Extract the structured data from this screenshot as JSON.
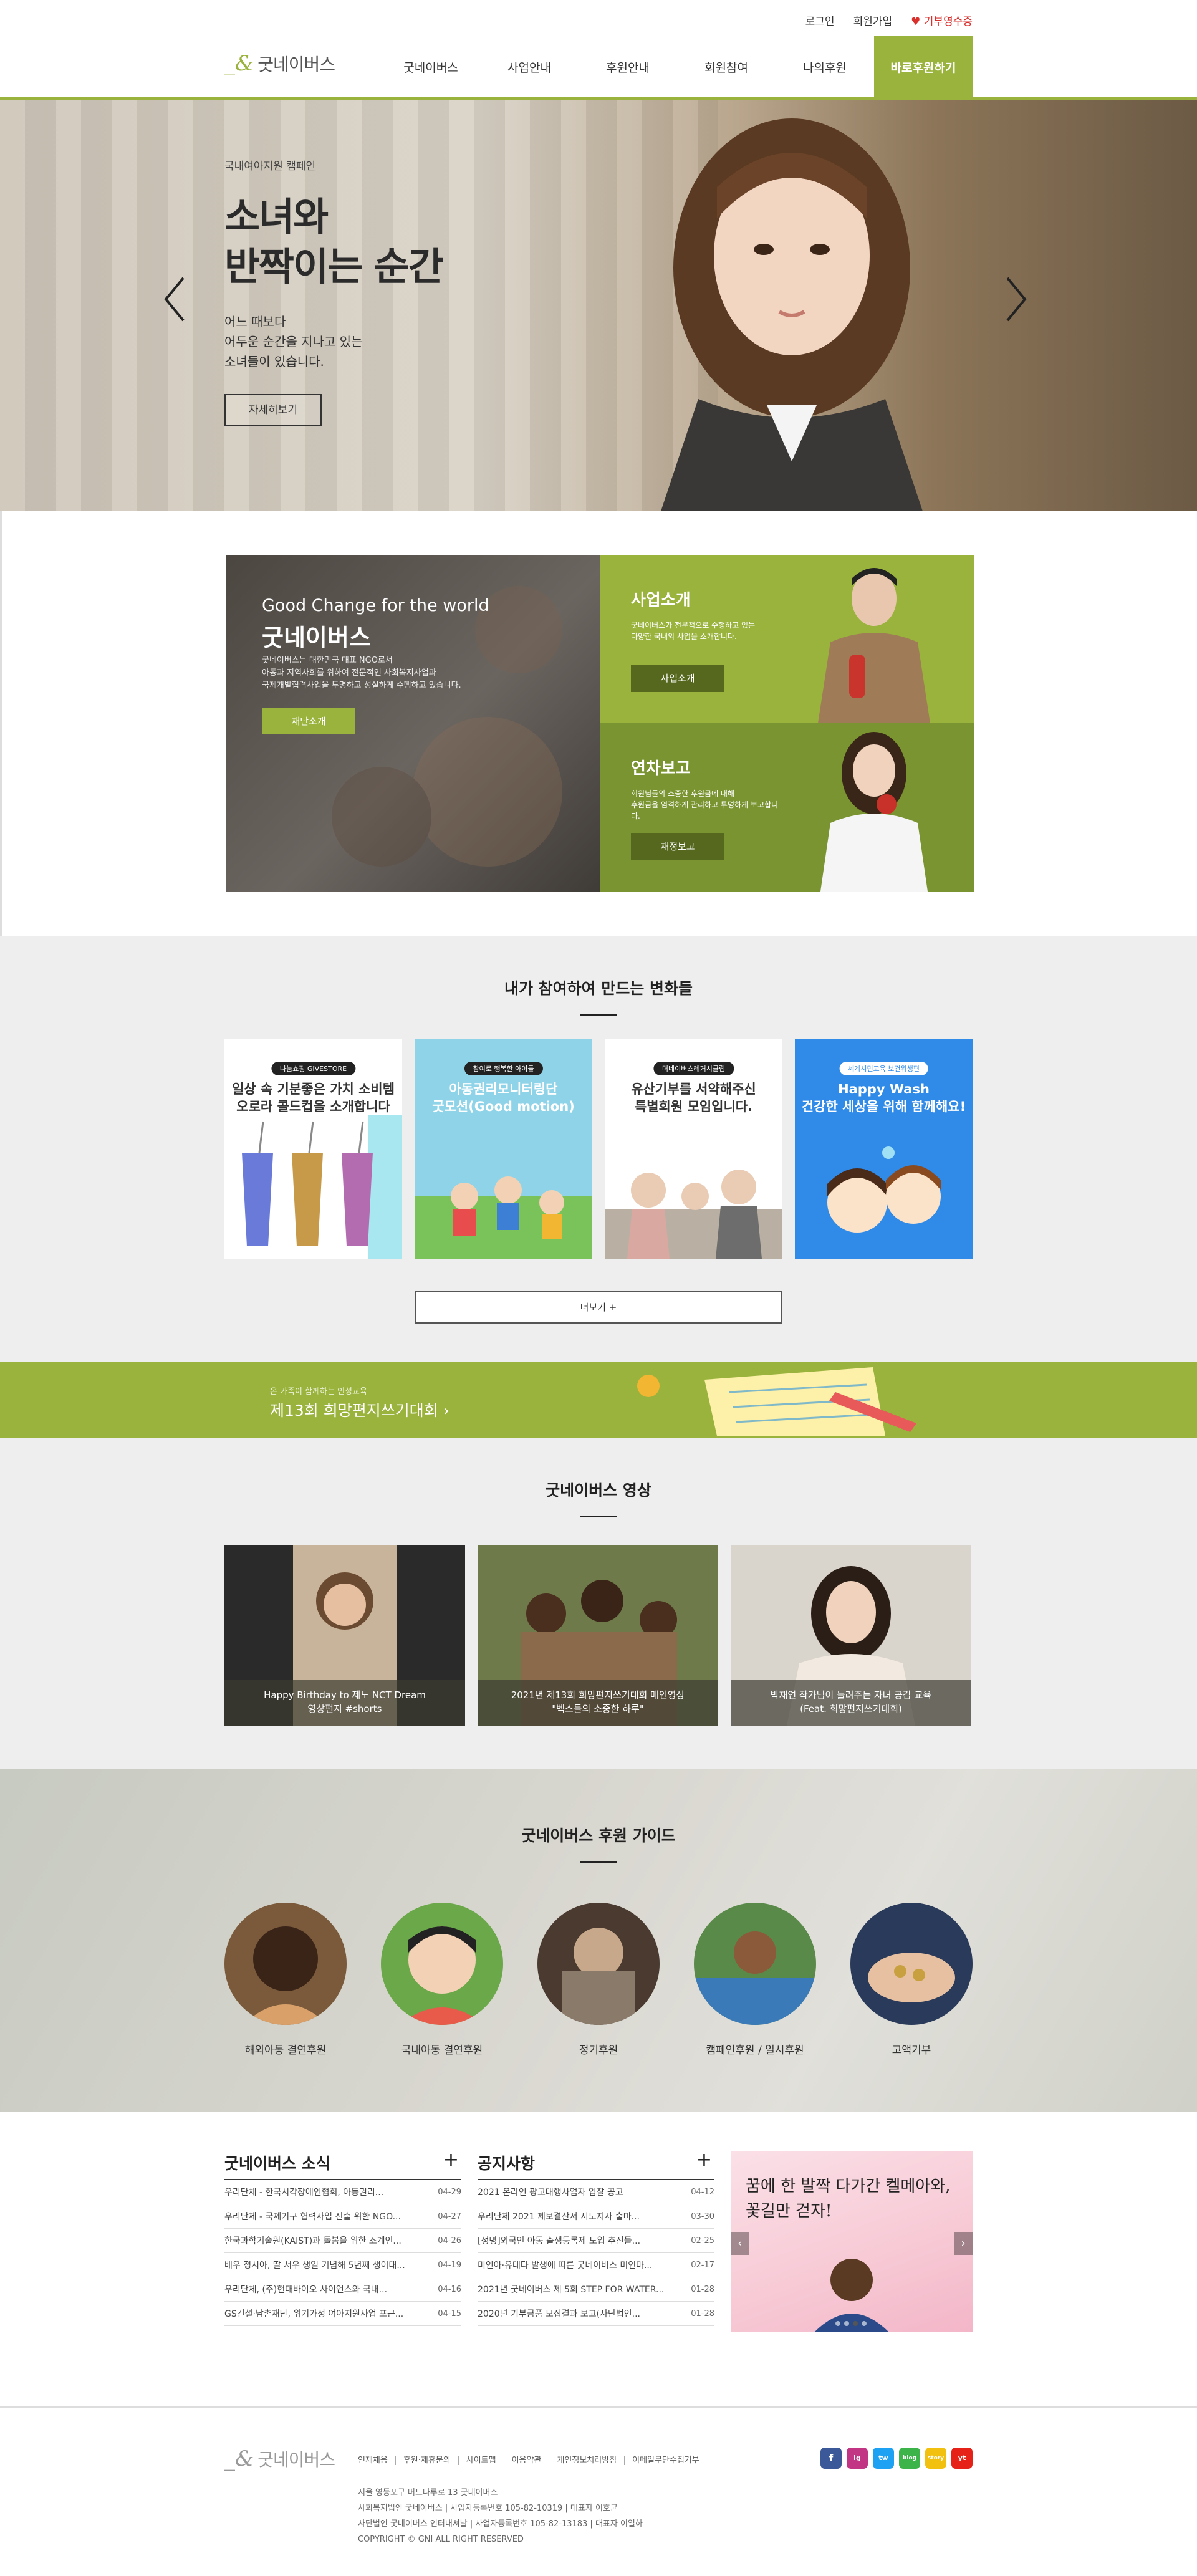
{
  "util": {
    "login": "로그인",
    "join": "회원가입",
    "receipt": "기부영수증"
  },
  "logo": {
    "text": "굿네이버스"
  },
  "gnb": [
    {
      "label": "굿네이버스"
    },
    {
      "label": "사업안내"
    },
    {
      "label": "후원안내"
    },
    {
      "label": "회원참여"
    },
    {
      "label": "나의후원"
    },
    {
      "label": "바로후원하기"
    }
  ],
  "hero": {
    "category": "국내여아지원 캠페인",
    "title_line1": "소녀와",
    "title_line2": "반짝이는 순간",
    "desc_line1": "어느 때보다",
    "desc_line2": "어두운 순간을 지나고 있는",
    "desc_line3": "소녀들이 있습니다.",
    "more": "자세히보기"
  },
  "intro": {
    "tagline": "Good Change for the world",
    "name": "굿네이버스",
    "desc_line1": "굿네이버스는 대한민국 대표 NGO로서",
    "desc_line2": "아동과 지역사회를 위하여 전문적인 사회복지사업과",
    "desc_line3": "국제개발협력사업을 투명하고 성실하게 수행하고 있습니다.",
    "foundation_btn": "재단소개",
    "biz_title": "사업소개",
    "biz_desc_line1": "굿네이버스가 전문적으로 수행하고 있는",
    "biz_desc_line2": "다양한 국내외 사업을 소개합니다.",
    "biz_btn": "사업소개",
    "report_title": "연차보고",
    "report_desc_line1": "회원님들의 소중한 후원금에 대해",
    "report_desc_line2": "후원금을 엄격하게 관리하고 투명하게 보고합니다.",
    "report_btn": "재정보고"
  },
  "participate": {
    "title": "내가 참여하여 만드는 변화들",
    "more": "더보기 +",
    "cards": [
      {
        "badge": "나눔쇼핑 GIVESTORE",
        "line1": "일상 속 기분좋은 가치 소비템",
        "line2": "오로라 콜드컵을 소개합니다"
      },
      {
        "badge": "참여로 행복한 아이들",
        "line1": "아동권리모니터링단",
        "line2": "굿모션(Good motion)"
      },
      {
        "badge": "더네이버스레거시클럽",
        "line1": "유산기부를 서약해주신",
        "line2": "특별회원 모임입니다."
      },
      {
        "badge": "세계시민교육 보건위생편",
        "line1": "Happy Wash",
        "line2": "건강한 세상을 위해 함께해요!"
      }
    ]
  },
  "banner": {
    "small": "온 가족이 함께하는 인성교육",
    "big": "제13회 희망편지쓰기대회 ›"
  },
  "video": {
    "title": "굿네이버스 영상",
    "items": [
      {
        "line1": "Happy Birthday to 제노 NCT Dream",
        "line2": "영상편지 #shorts"
      },
      {
        "line1": "2021년 제13회 희망편지쓰기대회 메인영상",
        "line2": "\"벡스들의 소중한 하루\""
      },
      {
        "line1": "박재연 작가님이 들려주는 자녀 공감 교육",
        "line2": "(Feat. 희망편지쓰기대회)"
      }
    ]
  },
  "guide": {
    "title": "굿네이버스 후원 가이드",
    "items": [
      {
        "label": "해외아동 결연후원"
      },
      {
        "label": "국내아동 결연후원"
      },
      {
        "label": "정기후원"
      },
      {
        "label": "캠페인후원 / 일시후원"
      },
      {
        "label": "고액기부"
      }
    ]
  },
  "news": {
    "title": "굿네이버스 소식",
    "items": [
      {
        "text": "우리단체 - 한국시각장애인협회, 아동권리...",
        "date": "04-29"
      },
      {
        "text": "우리단체 - 국제기구 협력사업 진출 위한 NGO...",
        "date": "04-27"
      },
      {
        "text": "한국과학기술원(KAIST)과 돌봄을 위한 조계인...",
        "date": "04-26"
      },
      {
        "text": "배우 정시아, 딸 서우 생일 기념해 5년째 생이대...",
        "date": "04-19"
      },
      {
        "text": "우리단체, (주)현대바이오 사이언스와 국내...",
        "date": "04-16"
      },
      {
        "text": "GS건설·남촌재단, 위기가정 여아지원사업 포근...",
        "date": "04-15"
      }
    ]
  },
  "notice": {
    "title": "공지사항",
    "items": [
      {
        "text": "2021 온라인 광고대행사업자 입찰 공고",
        "date": "04-12"
      },
      {
        "text": "우리단체 2021 제보결산서 시도지사 출마...",
        "date": "03-30"
      },
      {
        "text": "[성명]외국인 아동 출생등록제 도입 추진들...",
        "date": "02-25"
      },
      {
        "text": "미인아·유데타 발생에 따른 굿네이버스 미인마...",
        "date": "02-17"
      },
      {
        "text": "2021년 굿네이버스 제 5회 STEP FOR WATER...",
        "date": "01-28"
      },
      {
        "text": "2020년 기부금품 모집결과 보고(사단법인...",
        "date": "01-28"
      }
    ]
  },
  "promo": {
    "line1": "꿈에 한 발짝 다가간 켈메아와,",
    "line2": "꽃길만 걷자!"
  },
  "footer": {
    "links": [
      "인재채용",
      "후원·제휴문의",
      "사이트맵",
      "이용약관",
      "개인정보처리방침",
      "이메일무단수집거부"
    ],
    "info_line1": "서울 영등포구 버드나루로 13 굿네이버스",
    "info_line2": "사회복지법인 굿네이버스 | 사업자등록번호 105-82-10319 | 대표자 이호균",
    "info_line3": "사단법인 굿네이버스 인터내셔날 | 사업자등록번호 105-82-13183 | 대표자 이일하",
    "copyright": "COPYRIGHT © GNI ALL RIGHT RESERVED",
    "sns": [
      "f",
      "ig",
      "tw",
      "blog",
      "story",
      "yt"
    ]
  },
  "colors": {
    "accent": "#99b33d",
    "accent_dark": "#7a9431",
    "alert": "#d9302c"
  }
}
